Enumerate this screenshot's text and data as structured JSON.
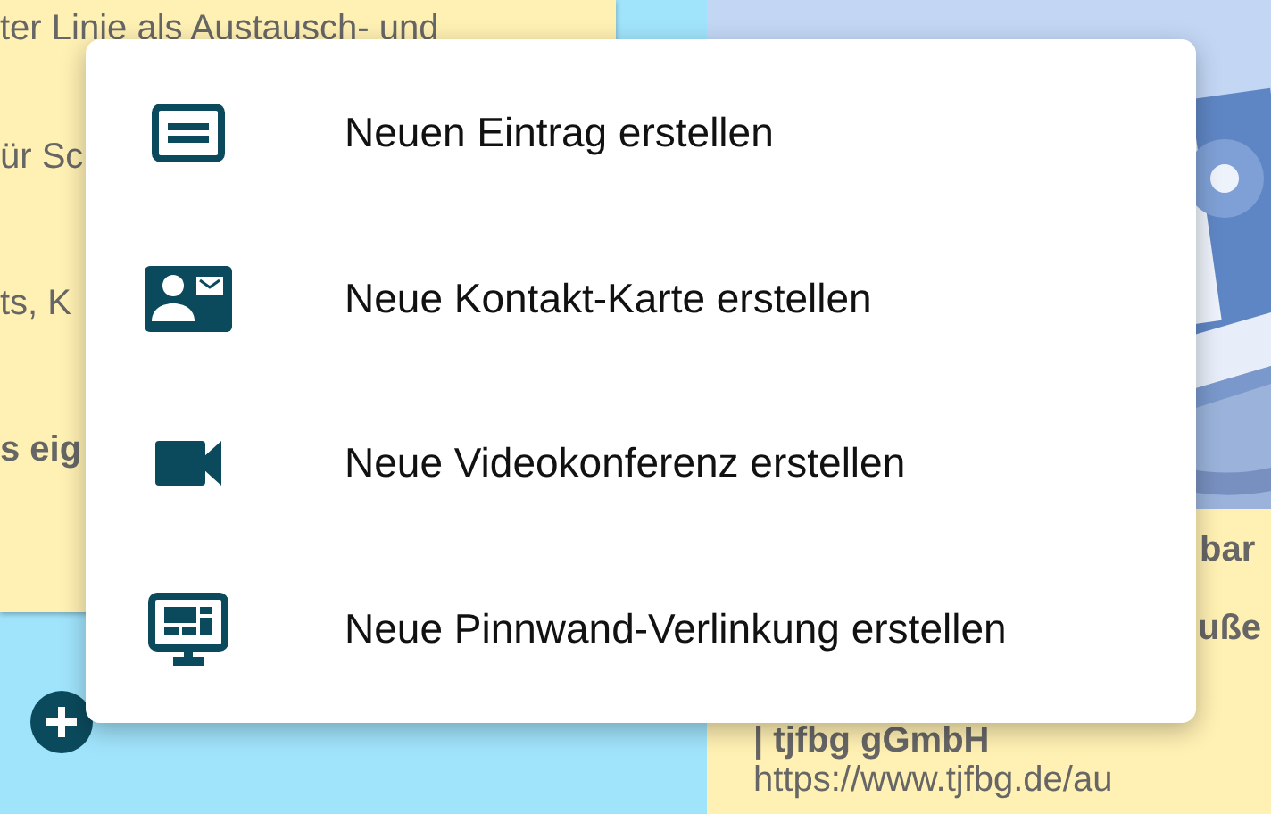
{
  "left_card": {
    "lines": [
      {
        "text": "ter Linie als Austausch- und",
        "bold": false
      },
      {
        "text": "ür Sc",
        "bold": false
      },
      {
        "text": "ts, K",
        "bold": false
      },
      {
        "text": "s eig",
        "bold": true
      }
    ]
  },
  "right_card": {
    "lines": [
      {
        "text": "bar",
        "bold": true
      },
      {
        "text": "uße",
        "bold": true
      },
      {
        "text": "| tjfbg gGmbH",
        "bold": true
      },
      {
        "text": "https://www.tjfbg.de/au",
        "bold": false
      }
    ]
  },
  "menu": {
    "items": [
      {
        "kind": "entry",
        "label": "Neuen Eintrag erstellen"
      },
      {
        "kind": "contact",
        "label": "Neue Kontakt-Karte erstellen"
      },
      {
        "kind": "video",
        "label": "Neue Videokonferenz erstellen"
      },
      {
        "kind": "pinboard",
        "label": "Neue Pinnwand-Verlinkung erstellen"
      }
    ]
  }
}
